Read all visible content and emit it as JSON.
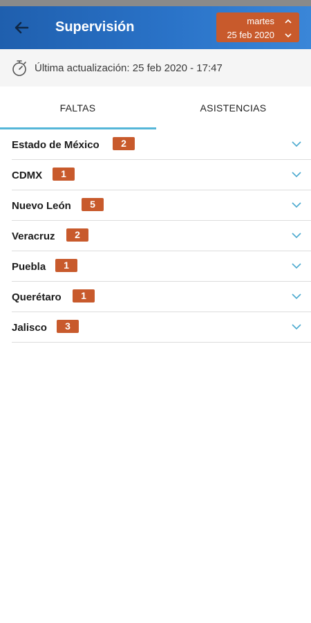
{
  "header": {
    "title": "Supervisión",
    "back_icon": "arrow-left-icon",
    "date": {
      "day": "martes",
      "full": "25 feb 2020"
    }
  },
  "update": {
    "text": "Última actualización: 25 feb 2020 - 17:47",
    "icon": "stopwatch-icon"
  },
  "tabs": [
    {
      "label": "FALTAS",
      "active": true
    },
    {
      "label": "ASISTENCIAS",
      "active": false
    }
  ],
  "states": [
    {
      "name": "Estado de México",
      "count": "2"
    },
    {
      "name": "CDMX",
      "count": "1"
    },
    {
      "name": "Nuevo León",
      "count": "5"
    },
    {
      "name": "Veracruz",
      "count": "2"
    },
    {
      "name": "Puebla",
      "count": "1"
    },
    {
      "name": "Querétaro",
      "count": "1"
    },
    {
      "name": "Jalisco",
      "count": "3"
    }
  ],
  "colors": {
    "appbar": "#2a73c8",
    "badge": "#c85a2c",
    "accent": "#55b6d8"
  }
}
